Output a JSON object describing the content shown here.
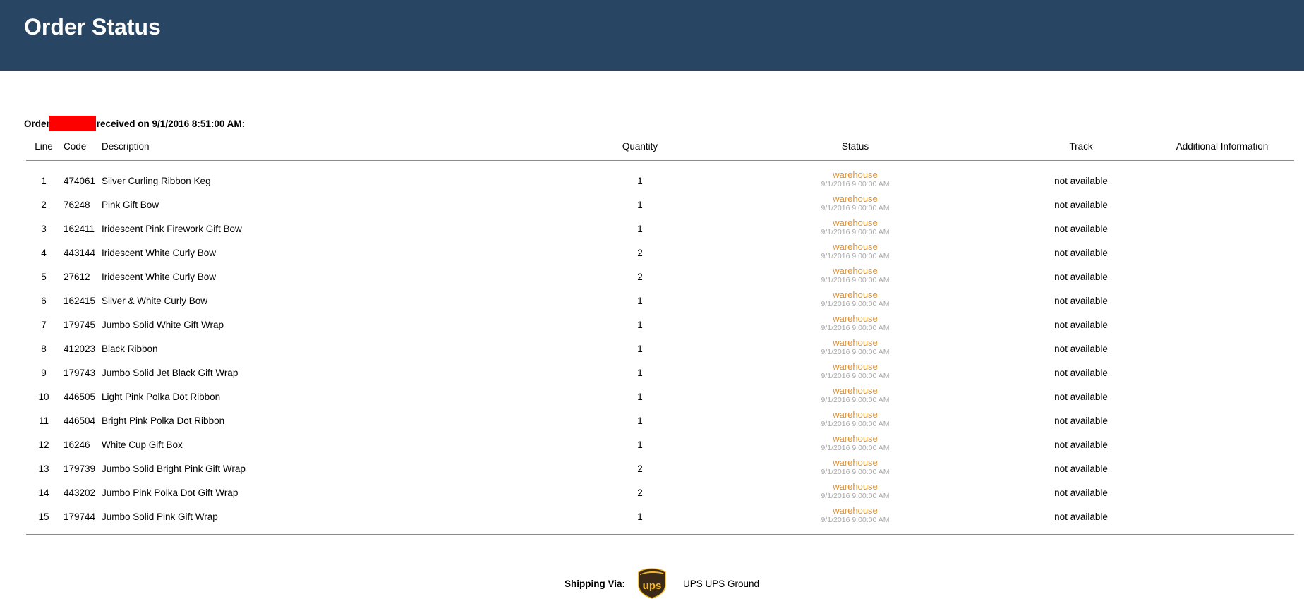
{
  "header": {
    "title": "Order Status"
  },
  "order": {
    "prefix": "Order",
    "suffix": "received on 9/1/2016 8:51:00 AM:"
  },
  "table": {
    "columns": {
      "line": "Line",
      "code": "Code",
      "description": "Description",
      "quantity": "Quantity",
      "status": "Status",
      "track": "Track",
      "info": "Additional Information"
    },
    "rows": [
      {
        "line": "1",
        "code": "474061",
        "description": "Silver Curling Ribbon Keg",
        "quantity": "1",
        "status": "warehouse",
        "status_date": "9/1/2016 9:00:00 AM",
        "track": "not available",
        "info": ""
      },
      {
        "line": "2",
        "code": "76248",
        "description": "Pink Gift Bow",
        "quantity": "1",
        "status": "warehouse",
        "status_date": "9/1/2016 9:00:00 AM",
        "track": "not available",
        "info": ""
      },
      {
        "line": "3",
        "code": "162411",
        "description": "Iridescent Pink Firework Gift Bow",
        "quantity": "1",
        "status": "warehouse",
        "status_date": "9/1/2016 9:00:00 AM",
        "track": "not available",
        "info": ""
      },
      {
        "line": "4",
        "code": "443144",
        "description": "Iridescent White Curly Bow",
        "quantity": "2",
        "status": "warehouse",
        "status_date": "9/1/2016 9:00:00 AM",
        "track": "not available",
        "info": ""
      },
      {
        "line": "5",
        "code": "27612",
        "description": "Iridescent White Curly Bow",
        "quantity": "2",
        "status": "warehouse",
        "status_date": "9/1/2016 9:00:00 AM",
        "track": "not available",
        "info": ""
      },
      {
        "line": "6",
        "code": "162415",
        "description": "Silver & White Curly Bow",
        "quantity": "1",
        "status": "warehouse",
        "status_date": "9/1/2016 9:00:00 AM",
        "track": "not available",
        "info": ""
      },
      {
        "line": "7",
        "code": "179745",
        "description": "Jumbo Solid White Gift Wrap",
        "quantity": "1",
        "status": "warehouse",
        "status_date": "9/1/2016 9:00:00 AM",
        "track": "not available",
        "info": ""
      },
      {
        "line": "8",
        "code": "412023",
        "description": "Black Ribbon",
        "quantity": "1",
        "status": "warehouse",
        "status_date": "9/1/2016 9:00:00 AM",
        "track": "not available",
        "info": ""
      },
      {
        "line": "9",
        "code": "179743",
        "description": "Jumbo Solid Jet Black Gift Wrap",
        "quantity": "1",
        "status": "warehouse",
        "status_date": "9/1/2016 9:00:00 AM",
        "track": "not available",
        "info": ""
      },
      {
        "line": "10",
        "code": "446505",
        "description": "Light Pink Polka Dot Ribbon",
        "quantity": "1",
        "status": "warehouse",
        "status_date": "9/1/2016 9:00:00 AM",
        "track": "not available",
        "info": ""
      },
      {
        "line": "11",
        "code": "446504",
        "description": "Bright Pink Polka Dot Ribbon",
        "quantity": "1",
        "status": "warehouse",
        "status_date": "9/1/2016 9:00:00 AM",
        "track": "not available",
        "info": ""
      },
      {
        "line": "12",
        "code": "16246",
        "description": "White Cup Gift Box",
        "quantity": "1",
        "status": "warehouse",
        "status_date": "9/1/2016 9:00:00 AM",
        "track": "not available",
        "info": ""
      },
      {
        "line": "13",
        "code": "179739",
        "description": "Jumbo Solid Bright Pink Gift Wrap",
        "quantity": "2",
        "status": "warehouse",
        "status_date": "9/1/2016 9:00:00 AM",
        "track": "not available",
        "info": ""
      },
      {
        "line": "14",
        "code": "443202",
        "description": "Jumbo Pink Polka Dot Gift Wrap",
        "quantity": "2",
        "status": "warehouse",
        "status_date": "9/1/2016 9:00:00 AM",
        "track": "not available",
        "info": ""
      },
      {
        "line": "15",
        "code": "179744",
        "description": "Jumbo Solid Pink Gift Wrap",
        "quantity": "1",
        "status": "warehouse",
        "status_date": "9/1/2016 9:00:00 AM",
        "track": "not available",
        "info": ""
      }
    ]
  },
  "shipping": {
    "label": "Shipping Via:",
    "logo_icon": "ups-logo-icon",
    "logo_text": "ups",
    "method": "UPS UPS Ground"
  },
  "colors": {
    "header_bg": "#294564",
    "status_text": "#e0902c",
    "status_date": "#a8a8a8",
    "redaction": "#ff0000"
  }
}
